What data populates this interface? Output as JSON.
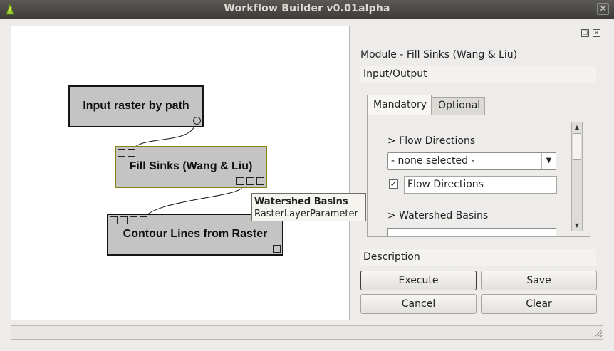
{
  "window": {
    "title": "Workflow Builder v0.01alpha",
    "close_glyph": "✕",
    "app_icon": "qgis-logo-icon"
  },
  "canvas": {
    "nodes": [
      {
        "id": "input",
        "label": "Input raster by path"
      },
      {
        "id": "fill",
        "label": "Fill Sinks (Wang & Liu)"
      },
      {
        "id": "contour",
        "label": "Contour Lines from Raster"
      }
    ],
    "tooltip": {
      "title": "Watershed Basins",
      "subtitle": "RasterLayerParameter"
    }
  },
  "panel": {
    "module_title": "Module - Fill Sinks (Wang & Liu)",
    "io_section": "Input/Output",
    "tabs": [
      {
        "label": "Mandatory",
        "active": true
      },
      {
        "label": "Optional",
        "active": false
      }
    ],
    "params": {
      "flow_directions_heading": "> Flow Directions",
      "flow_directions_combo": "- none selected -",
      "flow_directions_checked": true,
      "flow_directions_field": "Flow Directions",
      "watershed_heading": "> Watershed Basins"
    },
    "description_section": "Description",
    "buttons": {
      "execute": "Execute",
      "save": "Save",
      "cancel": "Cancel",
      "clear": "Clear"
    }
  },
  "colors": {
    "node_fill": "#c4c4c4",
    "selected_border": "#848414",
    "titlebar": "#3d3c39"
  }
}
